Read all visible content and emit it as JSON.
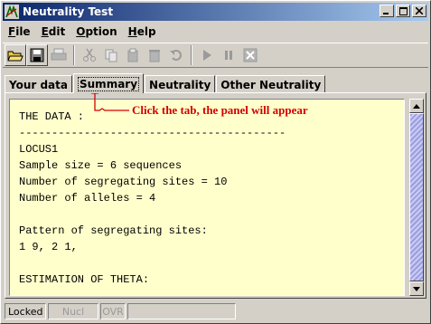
{
  "window": {
    "title": "Neutrality Test"
  },
  "menu": [
    {
      "label": "File",
      "key": "F",
      "rest": "ile"
    },
    {
      "label": "Edit",
      "key": "E",
      "rest": "dit"
    },
    {
      "label": "Option",
      "key": "O",
      "rest": "ption"
    },
    {
      "label": "Help",
      "key": "H",
      "rest": "elp"
    }
  ],
  "toolbar": {
    "buttons": [
      {
        "icon": "open-folder-icon",
        "enabled": true
      },
      {
        "icon": "save-icon",
        "enabled": true
      },
      {
        "icon": "print-icon",
        "enabled": false
      },
      {
        "icon": "cut-icon",
        "enabled": false
      },
      {
        "icon": "copy-icon",
        "enabled": false
      },
      {
        "icon": "paste-icon",
        "enabled": false
      },
      {
        "icon": "delete-icon",
        "enabled": false
      },
      {
        "icon": "undo-icon",
        "enabled": false
      },
      {
        "icon": "play-icon",
        "enabled": false
      },
      {
        "icon": "pause-icon",
        "enabled": false
      },
      {
        "icon": "stop-icon",
        "enabled": false
      }
    ]
  },
  "tabs": {
    "items": [
      "Your data",
      "Summary",
      "Neutrality",
      "Other Neutrality"
    ],
    "active": "Summary"
  },
  "annotation": "Click the tab, the panel will appear",
  "content": {
    "lines": [
      "THE DATA :",
      "-----------------------------------------",
      "LOCUS1",
      "Sample size = 6 sequences",
      "Number of segregating sites = 10",
      "Number of alleles = 4",
      "",
      "Pattern of segregating sites:",
      "1 9, 2 1,",
      "",
      "ESTIMATION OF THETA:"
    ]
  },
  "status": {
    "locked": "Locked",
    "nucl": "Nucl",
    "ovr": "OVR",
    "message": ""
  },
  "colors": {
    "title_start": "#0a246a",
    "title_end": "#a6caf0",
    "panel_bg": "#ffffcc",
    "annotation": "#d40000",
    "thumb": "#9b9ee0"
  }
}
